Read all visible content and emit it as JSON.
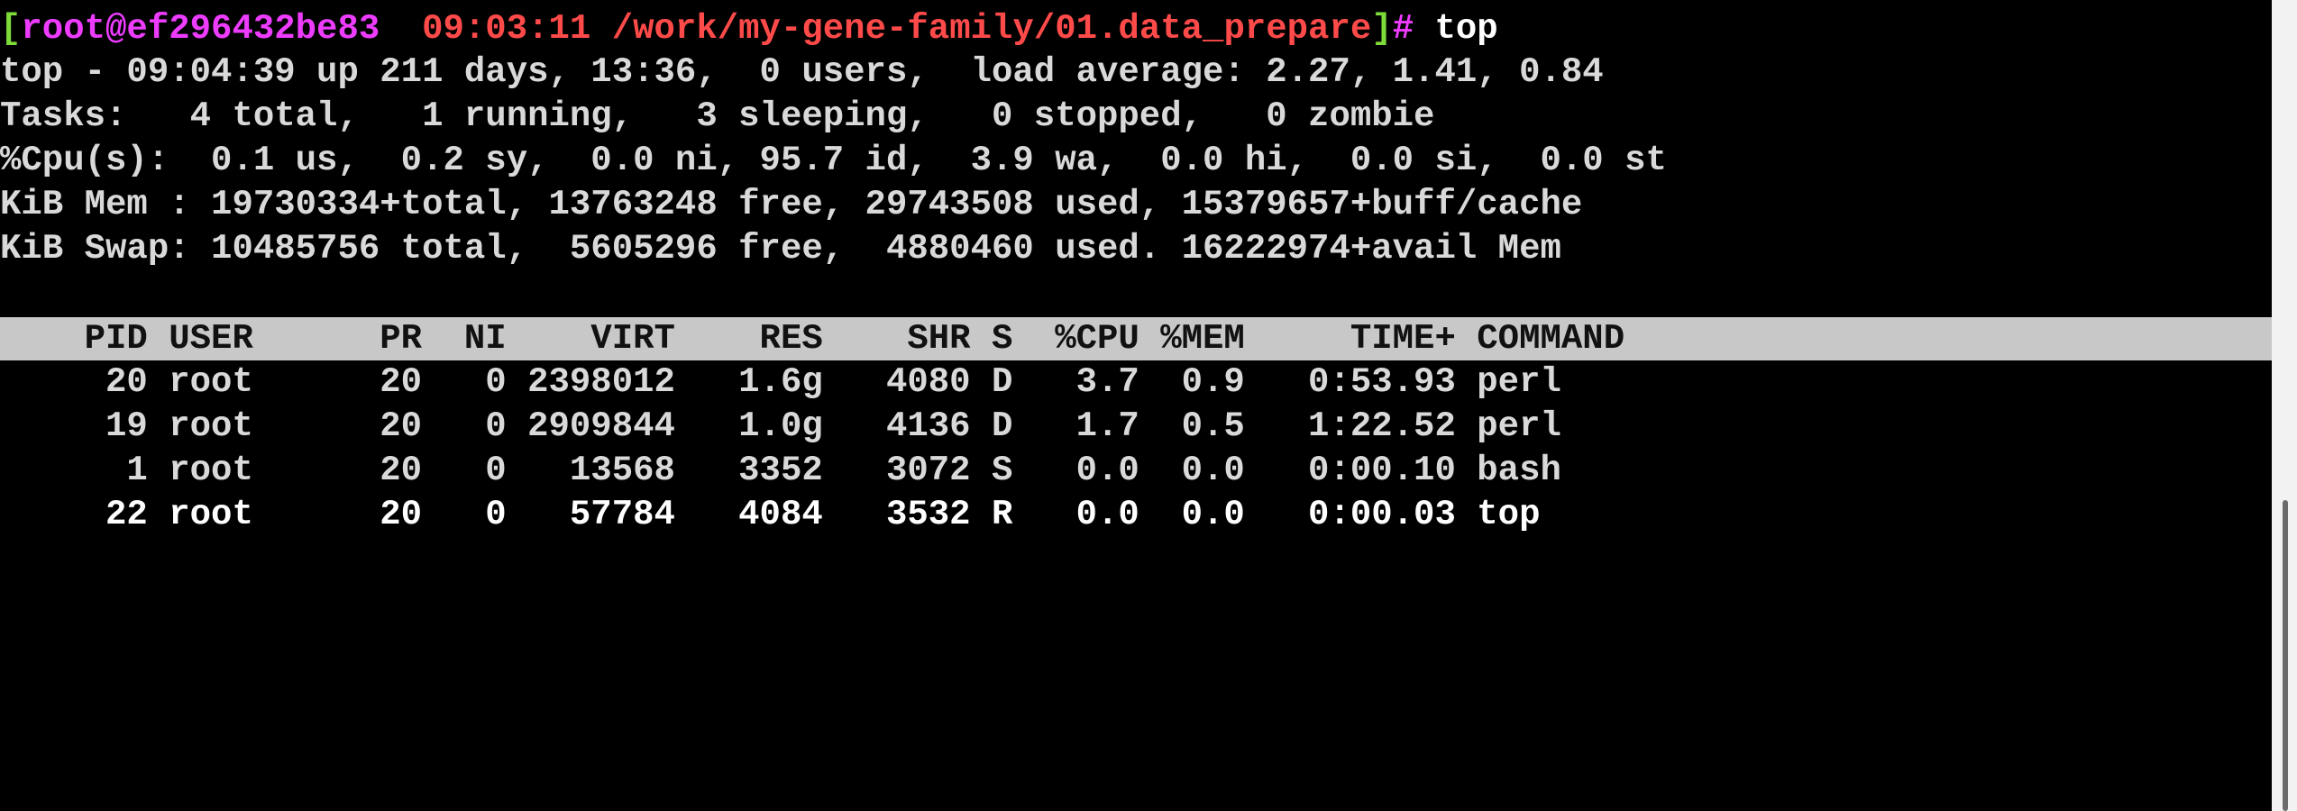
{
  "prompt": {
    "open_bracket": "[",
    "user_host": "root@ef296432be83",
    "time": "09:03:11",
    "path": "/work/my-gene-family/01.data_prepare",
    "close_bracket": "]",
    "symbol": "#",
    "command": " top"
  },
  "summary": {
    "line1": "top - 09:04:39 up 211 days, 13:36,  0 users,  load average: 2.27, 1.41, 0.84",
    "line2": "Tasks:   4 total,   1 running,   3 sleeping,   0 stopped,   0 zombie",
    "line3": "%Cpu(s):  0.1 us,  0.2 sy,  0.0 ni, 95.7 id,  3.9 wa,  0.0 hi,  0.0 si,  0.0 st",
    "line4": "KiB Mem : 19730334+total, 13763248 free, 29743508 used, 15379657+buff/cache",
    "line5": "KiB Swap: 10485756 total,  5605296 free,  4880460 used. 16222974+avail Mem"
  },
  "table": {
    "header": "    PID USER      PR  NI    VIRT    RES    SHR S  %CPU %MEM     TIME+ COMMAND",
    "rows": [
      "     20 root      20   0 2398012   1.6g   4080 D   3.7  0.9   0:53.93 perl",
      "     19 root      20   0 2909844   1.0g   4136 D   1.7  0.5   1:22.52 perl",
      "      1 root      20   0   13568   3352   3072 S   0.0  0.0   0:00.10 bash",
      "     22 root      20   0   57784   4084   3532 R   0.0  0.0   0:00.03 top"
    ]
  },
  "colors": {
    "green": "#7ddc3a",
    "magenta": "#ee3cff",
    "red": "#ff4a4a",
    "header_bg": "#c8c8c8",
    "background": "#000000"
  }
}
